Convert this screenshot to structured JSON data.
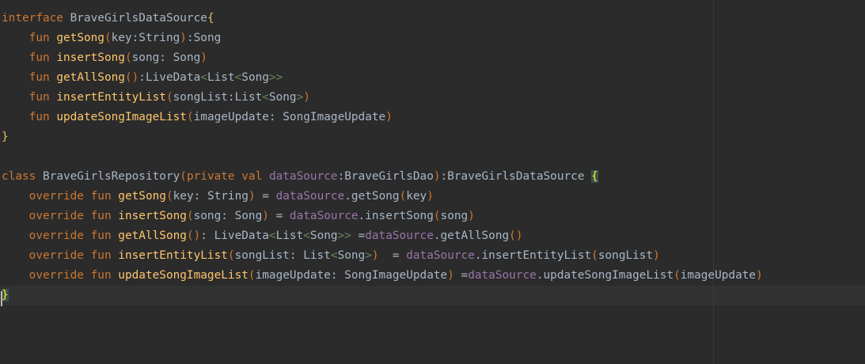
{
  "editor": {
    "lines": [
      [
        {
          "t": "interface",
          "c": "kw"
        },
        {
          "t": " BraveGirlsDataSource",
          "c": "ty"
        },
        {
          "t": "{",
          "c": "brace"
        }
      ],
      [
        {
          "t": "    ",
          "c": "plain"
        },
        {
          "t": "fun",
          "c": "kw"
        },
        {
          "t": " ",
          "c": "plain"
        },
        {
          "t": "getSong",
          "c": "fn"
        },
        {
          "t": "(",
          "c": "bk"
        },
        {
          "t": "key:String",
          "c": "plain"
        },
        {
          "t": ")",
          "c": "bk"
        },
        {
          "t": ":Song",
          "c": "plain"
        }
      ],
      [
        {
          "t": "    ",
          "c": "plain"
        },
        {
          "t": "fun",
          "c": "kw"
        },
        {
          "t": " ",
          "c": "plain"
        },
        {
          "t": "insertSong",
          "c": "fn"
        },
        {
          "t": "(",
          "c": "bk"
        },
        {
          "t": "song: Song",
          "c": "plain"
        },
        {
          "t": ")",
          "c": "bk"
        }
      ],
      [
        {
          "t": "    ",
          "c": "plain"
        },
        {
          "t": "fun",
          "c": "kw"
        },
        {
          "t": " ",
          "c": "plain"
        },
        {
          "t": "getAllSong",
          "c": "fn"
        },
        {
          "t": "()",
          "c": "bk"
        },
        {
          "t": ":LiveData",
          "c": "plain"
        },
        {
          "t": "<",
          "c": "lt"
        },
        {
          "t": "List",
          "c": "plain"
        },
        {
          "t": "<",
          "c": "lt"
        },
        {
          "t": "Song",
          "c": "plain"
        },
        {
          "t": ">>",
          "c": "lt"
        }
      ],
      [
        {
          "t": "    ",
          "c": "plain"
        },
        {
          "t": "fun",
          "c": "kw"
        },
        {
          "t": " ",
          "c": "plain"
        },
        {
          "t": "insertEntityList",
          "c": "fn"
        },
        {
          "t": "(",
          "c": "bk"
        },
        {
          "t": "songList:List",
          "c": "plain"
        },
        {
          "t": "<",
          "c": "lt"
        },
        {
          "t": "Song",
          "c": "plain"
        },
        {
          "t": ">",
          "c": "lt"
        },
        {
          "t": ")",
          "c": "bk"
        }
      ],
      [
        {
          "t": "    ",
          "c": "plain"
        },
        {
          "t": "fun",
          "c": "kw"
        },
        {
          "t": " ",
          "c": "plain"
        },
        {
          "t": "updateSongImageList",
          "c": "fn"
        },
        {
          "t": "(",
          "c": "bk"
        },
        {
          "t": "imageUpdate: SongImageUpdate",
          "c": "plain"
        },
        {
          "t": ")",
          "c": "bk"
        }
      ],
      [
        {
          "t": "}",
          "c": "brace"
        }
      ],
      [],
      [
        {
          "t": "class",
          "c": "kw"
        },
        {
          "t": " BraveGirlsRepository",
          "c": "ty"
        },
        {
          "t": "(",
          "c": "bk"
        },
        {
          "t": "private val",
          "c": "kw"
        },
        {
          "t": " ",
          "c": "plain"
        },
        {
          "t": "dataSource",
          "c": "pr"
        },
        {
          "t": ":BraveGirlsDao",
          "c": "plain"
        },
        {
          "t": ")",
          "c": "bk"
        },
        {
          "t": ":BraveGirlsDataSource ",
          "c": "plain"
        },
        {
          "t": "{",
          "c": "match"
        }
      ],
      [
        {
          "t": "    ",
          "c": "plain"
        },
        {
          "t": "override fun",
          "c": "kw"
        },
        {
          "t": " ",
          "c": "plain"
        },
        {
          "t": "getSong",
          "c": "fn"
        },
        {
          "t": "(",
          "c": "bk"
        },
        {
          "t": "key: String",
          "c": "plain"
        },
        {
          "t": ")",
          "c": "bk"
        },
        {
          "t": " = ",
          "c": "plain"
        },
        {
          "t": "dataSource",
          "c": "pr"
        },
        {
          "t": ".getSong",
          "c": "plain"
        },
        {
          "t": "(",
          "c": "bk"
        },
        {
          "t": "key",
          "c": "plain"
        },
        {
          "t": ")",
          "c": "bk"
        }
      ],
      [
        {
          "t": "    ",
          "c": "plain"
        },
        {
          "t": "override fun",
          "c": "kw"
        },
        {
          "t": " ",
          "c": "plain"
        },
        {
          "t": "insertSong",
          "c": "fn"
        },
        {
          "t": "(",
          "c": "bk"
        },
        {
          "t": "song: Song",
          "c": "plain"
        },
        {
          "t": ")",
          "c": "bk"
        },
        {
          "t": " = ",
          "c": "plain"
        },
        {
          "t": "dataSource",
          "c": "pr"
        },
        {
          "t": ".insertSong",
          "c": "plain"
        },
        {
          "t": "(",
          "c": "bk"
        },
        {
          "t": "song",
          "c": "plain"
        },
        {
          "t": ")",
          "c": "bk"
        }
      ],
      [
        {
          "t": "    ",
          "c": "plain"
        },
        {
          "t": "override fun",
          "c": "kw"
        },
        {
          "t": " ",
          "c": "plain"
        },
        {
          "t": "getAllSong",
          "c": "fn"
        },
        {
          "t": "()",
          "c": "bk"
        },
        {
          "t": ": LiveData",
          "c": "plain"
        },
        {
          "t": "<",
          "c": "lt"
        },
        {
          "t": "List",
          "c": "plain"
        },
        {
          "t": "<",
          "c": "lt"
        },
        {
          "t": "Song",
          "c": "plain"
        },
        {
          "t": ">>",
          "c": "lt"
        },
        {
          "t": " =",
          "c": "plain"
        },
        {
          "t": "dataSource",
          "c": "pr"
        },
        {
          "t": ".getAllSong",
          "c": "plain"
        },
        {
          "t": "()",
          "c": "bk"
        }
      ],
      [
        {
          "t": "    ",
          "c": "plain"
        },
        {
          "t": "override fun",
          "c": "kw"
        },
        {
          "t": " ",
          "c": "plain"
        },
        {
          "t": "insertEntityList",
          "c": "fn"
        },
        {
          "t": "(",
          "c": "bk"
        },
        {
          "t": "songList: List",
          "c": "plain"
        },
        {
          "t": "<",
          "c": "lt"
        },
        {
          "t": "Song",
          "c": "plain"
        },
        {
          "t": ">",
          "c": "lt"
        },
        {
          "t": ")",
          "c": "bk"
        },
        {
          "t": "  = ",
          "c": "plain"
        },
        {
          "t": "dataSource",
          "c": "pr"
        },
        {
          "t": ".insertEntityList",
          "c": "plain"
        },
        {
          "t": "(",
          "c": "bk"
        },
        {
          "t": "songList",
          "c": "plain"
        },
        {
          "t": ")",
          "c": "bk"
        }
      ],
      [
        {
          "t": "    ",
          "c": "plain"
        },
        {
          "t": "override fun",
          "c": "kw"
        },
        {
          "t": " ",
          "c": "plain"
        },
        {
          "t": "updateSongImageList",
          "c": "fn"
        },
        {
          "t": "(",
          "c": "bk"
        },
        {
          "t": "imageUpdate: SongImageUpdate",
          "c": "plain"
        },
        {
          "t": ")",
          "c": "bk"
        },
        {
          "t": " =",
          "c": "plain"
        },
        {
          "t": "dataSource",
          "c": "pr"
        },
        {
          "t": ".updateSongImageList",
          "c": "plain"
        },
        {
          "t": "(",
          "c": "bk"
        },
        {
          "t": "imageUpdate",
          "c": "plain"
        },
        {
          "t": ")",
          "c": "bk"
        }
      ],
      [
        {
          "t": "}",
          "c": "match",
          "caret": true
        }
      ]
    ]
  }
}
